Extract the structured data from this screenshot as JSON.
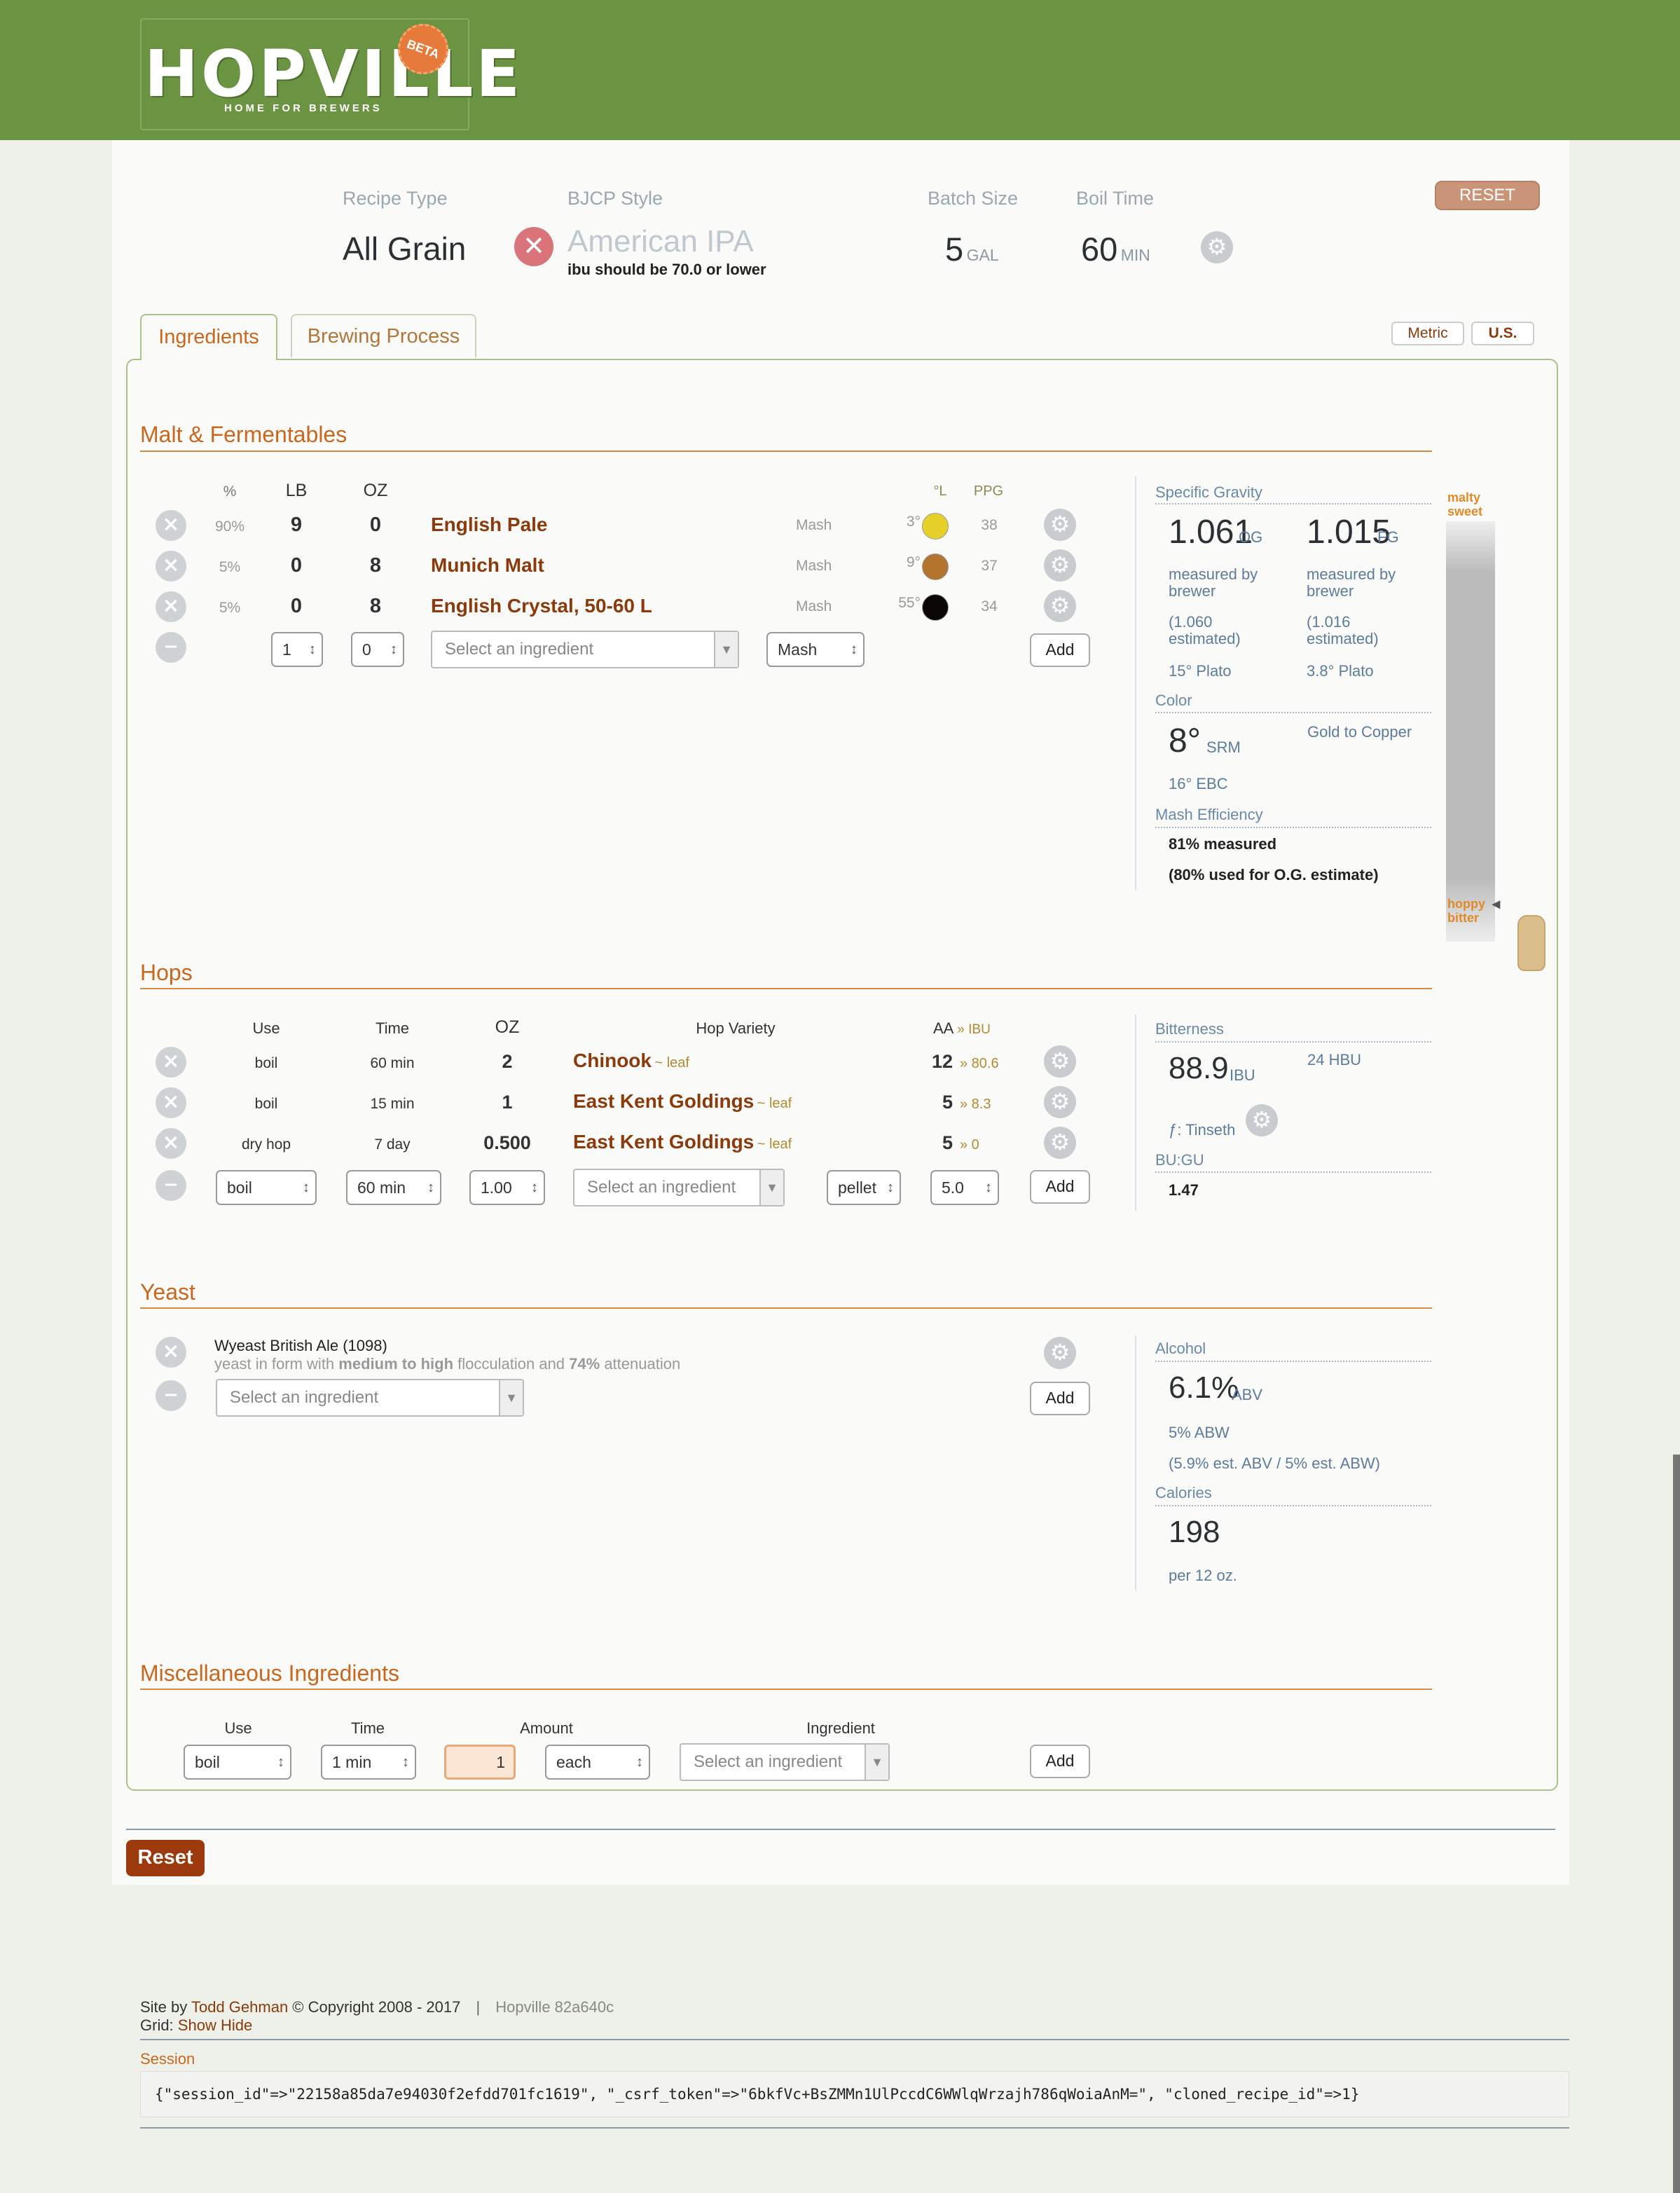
{
  "header": {
    "logo_text": "HOPVILLE",
    "logo_sub": "HOME FOR BREWERS",
    "beta": "BETA"
  },
  "recipe": {
    "type_label": "Recipe Type",
    "type_value": "All Grain",
    "style_label": "BJCP Style",
    "style_value": "American IPA",
    "style_warning": "ibu should be 70.0 or lower",
    "batch_label": "Batch Size",
    "batch_value": "5",
    "batch_unit": "GAL",
    "boil_label": "Boil Time",
    "boil_value": "60",
    "boil_unit": "MIN",
    "reset": "RESET"
  },
  "tabs": {
    "ingredients": "Ingredients",
    "process": "Brewing Process",
    "metric": "Metric",
    "us": "U.S."
  },
  "malt": {
    "title": "Malt & Fermentables",
    "headers": {
      "pct": "%",
      "lb": "LB",
      "oz": "OZ",
      "lov": "°L",
      "ppg": "PPG"
    },
    "rows": [
      {
        "pct": "90%",
        "lb": "9",
        "oz": "0",
        "name": "English Pale",
        "use": "Mash",
        "lov": "3°",
        "color": "#e6d12a",
        "ppg": "38"
      },
      {
        "pct": "5%",
        "lb": "0",
        "oz": "8",
        "name": "Munich Malt",
        "use": "Mash",
        "lov": "9°",
        "color": "#b3742e",
        "ppg": "37"
      },
      {
        "pct": "5%",
        "lb": "0",
        "oz": "8",
        "name": "English Crystal, 50-60 L",
        "use": "Mash",
        "lov": "55°",
        "color": "#0a0705",
        "ppg": "34"
      }
    ],
    "add": {
      "lb": "1",
      "oz": "0",
      "placeholder": "Select an ingredient",
      "use": "Mash",
      "button": "Add"
    }
  },
  "gravity": {
    "label": "Specific Gravity",
    "og": "1.061",
    "og_unit": "OG",
    "fg": "1.015",
    "fg_unit": "FG",
    "og_note": "measured by brewer",
    "fg_note": "measured by brewer",
    "og_est": "(1.060 estimated)",
    "fg_est": "(1.016 estimated)",
    "og_plato": "15° Plato",
    "fg_plato": "3.8° Plato",
    "color_label": "Color",
    "srm": "8°",
    "srm_unit": "SRM",
    "color_desc": "Gold to Copper",
    "ebc": "16° EBC",
    "eff_label": "Mash Efficiency",
    "eff_measured": "81% measured",
    "eff_used": "(80% used for O.G. estimate)",
    "malty": "malty sweet",
    "hoppy": "hoppy bitter",
    "balance_level": 0.96
  },
  "hops": {
    "title": "Hops",
    "headers": {
      "use": "Use",
      "time": "Time",
      "oz": "OZ",
      "variety": "Hop Variety",
      "aa": "AA",
      "ibu": "» IBU"
    },
    "rows": [
      {
        "use": "boil",
        "time": "60 min",
        "oz": "2",
        "name": "Chinook",
        "form": "~ leaf",
        "aa": "12",
        "ibu": "» 80.6"
      },
      {
        "use": "boil",
        "time": "15 min",
        "oz": "1",
        "name": "East Kent Goldings",
        "form": "~ leaf",
        "aa": "5",
        "ibu": "» 8.3"
      },
      {
        "use": "dry hop",
        "time": "7 day",
        "oz": "0.500",
        "name": "East Kent Goldings",
        "form": "~ leaf",
        "aa": "5",
        "ibu": "» 0"
      }
    ],
    "add": {
      "use": "boil",
      "time": "60 min",
      "oz": "1.00",
      "placeholder": "Select an ingredient",
      "form": "pellet",
      "aa": "5.0",
      "button": "Add"
    }
  },
  "bitterness": {
    "label": "Bitterness",
    "ibu": "88.9",
    "ibu_unit": "IBU",
    "hbu": "24 HBU",
    "formula": "ƒ: Tinseth",
    "bugu_label": "BU:GU",
    "bugu": "1.47"
  },
  "yeast": {
    "title": "Yeast",
    "name": "Wyeast British Ale (1098)",
    "desc_a": "yeast in form with ",
    "desc_b": "medium to high",
    "desc_c": " flocculation and ",
    "desc_d": "74%",
    "desc_e": " attenuation",
    "placeholder": "Select an ingredient",
    "button": "Add"
  },
  "alcohol": {
    "label": "Alcohol",
    "abv": "6.1%",
    "abv_unit": "ABV",
    "abw": "5% ABW",
    "est": "(5.9% est. ABV / 5% est. ABW)",
    "cal_label": "Calories",
    "cal": "198",
    "cal_note": "per 12 oz."
  },
  "misc": {
    "title": "Miscellaneous Ingredients",
    "headers": {
      "use": "Use",
      "time": "Time",
      "amount": "Amount",
      "ingredient": "Ingredient"
    },
    "use": "boil",
    "time": "1 min",
    "amount": "1",
    "unit": "each",
    "placeholder": "Select an ingredient",
    "button": "Add"
  },
  "reset_button": "Reset",
  "footer": {
    "site_by": "Site by ",
    "author": "Todd Gehman",
    "copyright": " © Copyright 2008 - 2017",
    "sep": "|",
    "version": "Hopville 82a640c",
    "grid": "Grid: ",
    "show": "Show",
    "hide": "Hide",
    "session_label": "Session",
    "session_text": "{\"session_id\"=>\"22158a85da7e94030f2efdd701fc1619\", \"_csrf_token\"=>\"6bkfVc+BsZMMn1UlPccdC6WWlqWrzajh786qWoiaAnM=\", \"cloned_recipe_id\"=>1}"
  }
}
